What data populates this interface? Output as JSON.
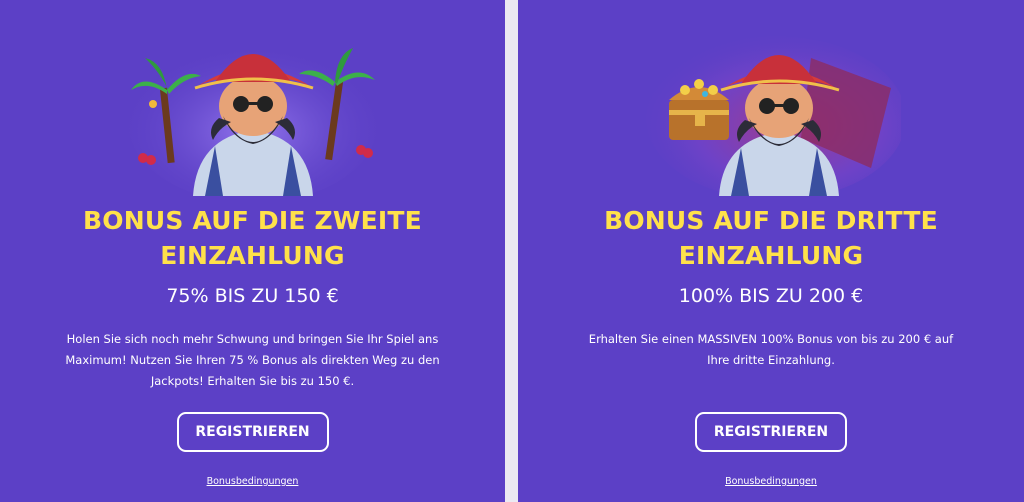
{
  "cards": [
    {
      "image_name": "pirate-palm-illustration",
      "title_line1": "BONUS AUF DIE ZWEITE",
      "title_line2": "EINZAHLUNG",
      "subtitle": "75% BIS ZU 150 €",
      "desc_line1": "Holen Sie sich noch mehr Schwung und bringen Sie Ihr Spiel ans",
      "desc_line2": "Maximum! Nutzen Sie Ihren 75 % Bonus als direkten Weg zu den",
      "desc_line3": "Jackpots! Erhalten Sie bis zu 150 €.",
      "button_label": "REGISTRIEREN",
      "terms_label": "Bonusbedingungen"
    },
    {
      "image_name": "pirate-treasure-chest-illustration",
      "title_line1": "BONUS AUF DIE DRITTE",
      "title_line2": "EINZAHLUNG",
      "subtitle": "100% BIS ZU 200 €",
      "desc_line1": "Erhalten Sie einen MASSIVEN 100% Bonus von bis zu 200 € auf",
      "desc_line2": "Ihre dritte Einzahlung.",
      "desc_line3": "",
      "button_label": "REGISTRIEREN",
      "terms_label": "Bonusbedingungen"
    }
  ],
  "colors": {
    "card_background": "#5c40c6",
    "title": "#ffe14a",
    "text": "#ffffff",
    "page_background": "#ebe9f2"
  }
}
